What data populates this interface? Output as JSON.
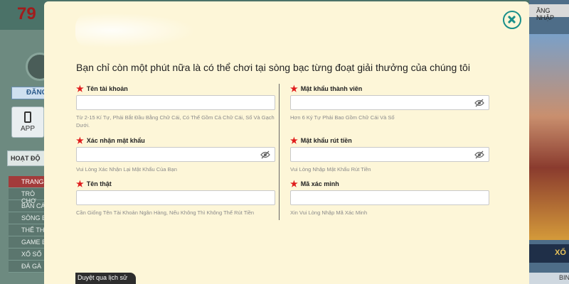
{
  "background": {
    "logo_text": "79",
    "login_button_label": "ĐĂNG",
    "app_label": "APP",
    "activity_label": "HOẠT ĐỘ",
    "menu_items": [
      "TRANG C",
      "TRÒ CHƠ",
      "BẮN CÁ",
      "SÒNG BẠ",
      "THỂ THA",
      "GAME BÀ",
      "XỔ SỐ",
      "ĐÁ GÀ"
    ],
    "right_top_label": "ĂNG NHẬP",
    "right_strip_label": "XỔ",
    "right_bottom_label": "BINA"
  },
  "modal": {
    "headline": "Bạn chỉ còn một phút nữa là có thể chơi tại sòng bạc từng đoạt giải thưởng của chúng tôi",
    "fields": {
      "username": {
        "label": "Tên tài khoản",
        "value": "",
        "hint": "Từ 2-15 Kí Tự, Phải Bắt Đầu Bằng Chữ Cái, Có Thể Gồm Cả Chữ Cái, Số Và Gạch Dưới."
      },
      "password": {
        "label": "Mật khẩu thành viên",
        "value": "",
        "hint": "Hơn 6 Ký Tự Phải Bao Gồm Chữ Cái Và Số"
      },
      "confirm_password": {
        "label": "Xác nhận mật khẩu",
        "value": "",
        "hint": "Vui Lòng Xác Nhận Lại Mật Khẩu Của Bạn"
      },
      "withdraw_password": {
        "label": "Mật khẩu rút tiền",
        "value": "",
        "hint": "Vui Lòng Nhập Mật Khẩu Rút Tiền"
      },
      "real_name": {
        "label": "Tên thật",
        "value": "",
        "hint": "Cần Giống Tên Tài Khoản Ngân Hàng, Nếu Không Thì Không Thể Rút Tiền"
      },
      "verification_code": {
        "label": "Mã xác minh",
        "value": "",
        "hint": "Xin Vui Lòng Nhập Mã Xác Minh"
      }
    },
    "history_tab_label": "Duyệt qua lịch sử"
  },
  "colors": {
    "modal_bg": "#fdf6d8",
    "required_star": "#e01b1b",
    "close_accent": "#1a8f8a"
  }
}
